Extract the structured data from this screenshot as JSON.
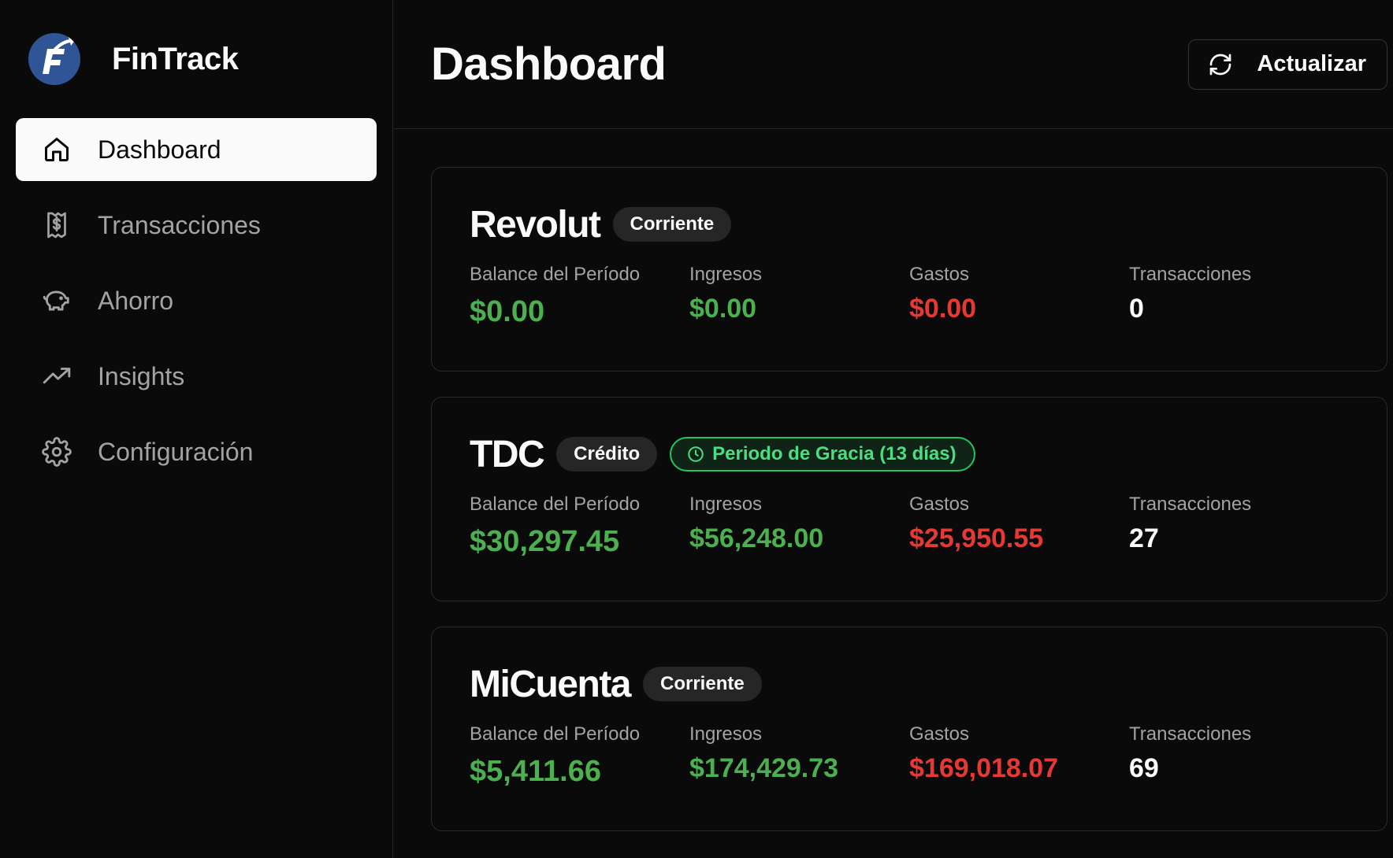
{
  "brand": {
    "name": "FinTrack"
  },
  "sidebar": {
    "items": [
      {
        "label": "Dashboard",
        "icon": "home-icon",
        "active": true
      },
      {
        "label": "Transacciones",
        "icon": "receipt-icon",
        "active": false
      },
      {
        "label": "Ahorro",
        "icon": "piggy-bank-icon",
        "active": false
      },
      {
        "label": "Insights",
        "icon": "trending-up-icon",
        "active": false
      },
      {
        "label": "Configuración",
        "icon": "gear-icon",
        "active": false
      }
    ]
  },
  "header": {
    "title": "Dashboard",
    "refresh_label": "Actualizar",
    "refresh_icon": "refresh-icon"
  },
  "stat_labels": {
    "balance": "Balance del Período",
    "income": "Ingresos",
    "expenses": "Gastos",
    "transactions": "Transacciones"
  },
  "accounts": [
    {
      "name": "Revolut",
      "type": "Corriente",
      "grace": null,
      "balance": "$0.00",
      "income": "$0.00",
      "expenses": "$0.00",
      "transactions": "0"
    },
    {
      "name": "TDC",
      "type": "Crédito",
      "grace": "Periodo de Gracia (13 días)",
      "balance": "$30,297.45",
      "income": "$56,248.00",
      "expenses": "$25,950.55",
      "transactions": "27"
    },
    {
      "name": "MiCuenta",
      "type": "Corriente",
      "grace": null,
      "balance": "$5,411.66",
      "income": "$174,429.73",
      "expenses": "$169,018.07",
      "transactions": "69"
    }
  ],
  "colors": {
    "positive": "#4caf50",
    "negative": "#e53935",
    "grace": "#4ade80",
    "brand": "#2f5597"
  }
}
